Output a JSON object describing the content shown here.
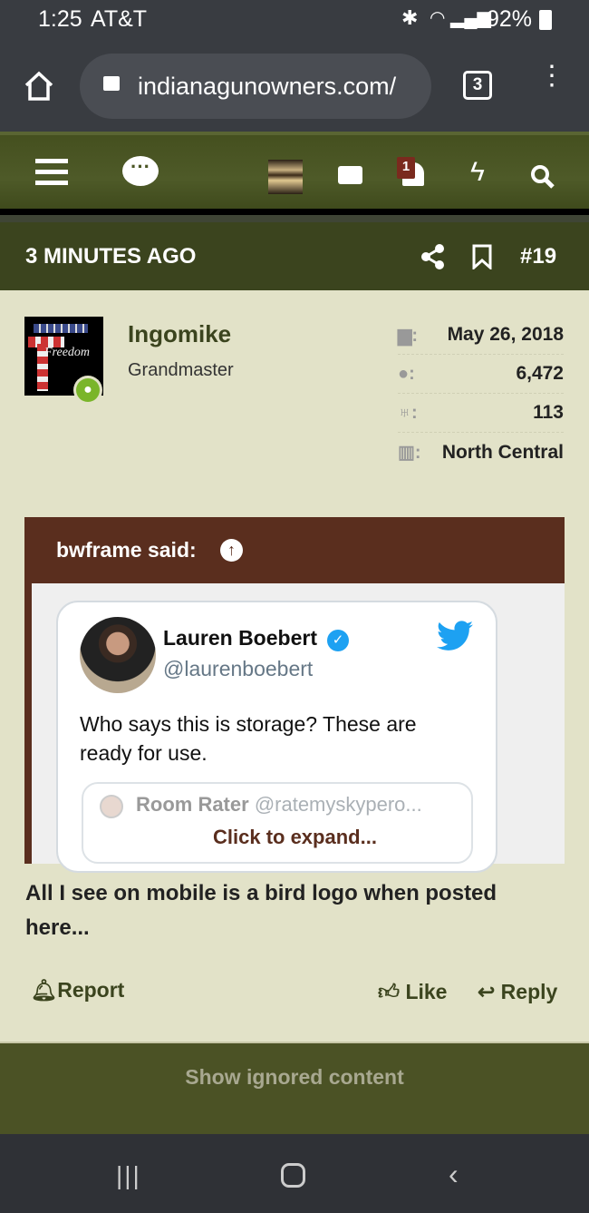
{
  "status_bar": {
    "time": "1:25",
    "carrier": "AT&T",
    "battery": "92%"
  },
  "browser": {
    "url": "indianagunowners.com/",
    "tab_count": "3"
  },
  "nav": {
    "notification_count": "1",
    "icons": [
      "menu-icon",
      "chat-icon",
      "user-avatar",
      "envelope-icon",
      "bell-icon",
      "bolt-icon",
      "search-icon"
    ]
  },
  "post_header": {
    "time": "3 MINUTES AGO",
    "number": "#19"
  },
  "user": {
    "name": "Ingomike",
    "title": "Grandmaster",
    "avatar_text": "Freedom",
    "stats": [
      {
        "icon": "calendar-icon",
        "value": "May 26, 2018"
      },
      {
        "icon": "comments-icon",
        "value": "6,472"
      },
      {
        "icon": "trophy-icon",
        "value": "113"
      },
      {
        "icon": "map-icon",
        "value": "North Central"
      }
    ]
  },
  "quote": {
    "author": "bwframe said:",
    "tweet": {
      "name": "Lauren Boebert",
      "handle": "@laurenboebert",
      "text": "Who says this is storage? These are ready for use.",
      "quoted_name": "Room Rater",
      "quoted_handle": "@ratemyskypero..."
    },
    "expand": "Click to expand..."
  },
  "post_body": "All I see on mobile is a bird logo when posted here...",
  "actions": {
    "report": "Report",
    "like": "Like",
    "reply": "Reply"
  },
  "footer": {
    "show_ignored": "Show ignored content"
  },
  "colors": {
    "nav": "#4b5625",
    "header": "#3b441e",
    "background": "#e2e2c8",
    "quote": "#5a2e1e",
    "username": "#3b441e",
    "twitter": "#1da1f2"
  }
}
